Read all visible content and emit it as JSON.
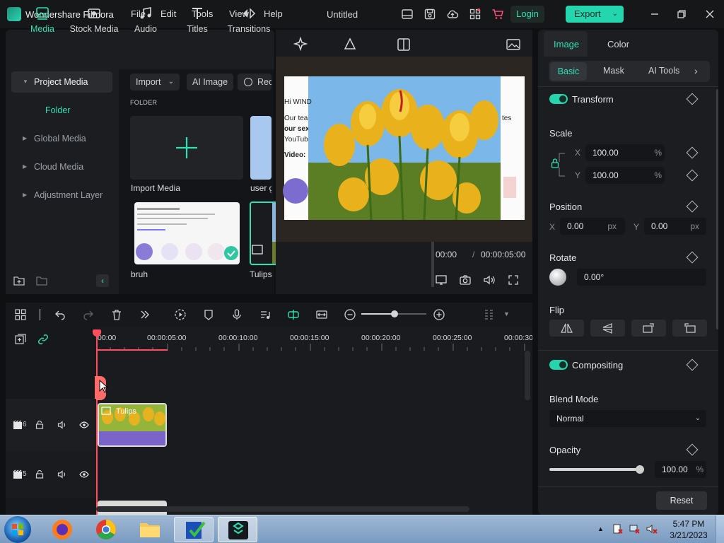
{
  "titlebar": {
    "app_name": "Wondershare Filmora",
    "menus": [
      "File",
      "Edit",
      "Tools",
      "View",
      "Help"
    ],
    "document_title": "Untitled",
    "login_label": "Login",
    "export_label": "Export"
  },
  "media_tabs": [
    {
      "label": "Media",
      "icon": "media-icon"
    },
    {
      "label": "Stock Media",
      "icon": "stock-media-icon"
    },
    {
      "label": "Audio",
      "icon": "music-note-icon"
    },
    {
      "label": "Titles",
      "icon": "text-t-icon"
    },
    {
      "label": "Transitions",
      "icon": "transitions-icon"
    }
  ],
  "preview_tabs_partial": [
    "Effects",
    "Stickers",
    "Templates"
  ],
  "sidebar": {
    "items": [
      {
        "label": "Project Media",
        "active": true
      },
      {
        "label": "Global Media",
        "active": false
      },
      {
        "label": "Cloud Media",
        "active": false
      },
      {
        "label": "Adjustment Layer",
        "active": false
      }
    ],
    "folder_label": "Folder"
  },
  "media_toolbar": {
    "import_label": "Import",
    "ai_image_label": "AI Image",
    "record_label": "Rec"
  },
  "media_grid": {
    "folder_heading": "FOLDER",
    "tiles": [
      {
        "label": "Import Media"
      },
      {
        "label": "user g"
      },
      {
        "label": "bruh"
      },
      {
        "label": "Tulips"
      }
    ]
  },
  "preview": {
    "current_time": "00:00",
    "separator": "/",
    "total_time": "00:00:05:00",
    "doc_text": [
      "Hi WIND",
      "Our team",
      "our sex",
      "YouTube",
      "Video:",
      "tes"
    ]
  },
  "properties": {
    "tabs": [
      "Image",
      "Color"
    ],
    "active_tab": "Image",
    "sub_tabs": [
      "Basic",
      "Mask",
      "AI Tools"
    ],
    "active_sub_tab": "Basic",
    "transform": {
      "label": "Transform",
      "enabled": true
    },
    "scale": {
      "label": "Scale",
      "x_label": "X",
      "x": "100.00",
      "y_label": "Y",
      "y": "100.00",
      "unit": "%"
    },
    "position": {
      "label": "Position",
      "x_label": "X",
      "x": "0.00",
      "y_label": "Y",
      "y": "0.00",
      "unit": "px"
    },
    "rotate": {
      "label": "Rotate",
      "value": "0.00°"
    },
    "flip": {
      "label": "Flip"
    },
    "compositing": {
      "label": "Compositing",
      "enabled": true
    },
    "blend_mode": {
      "label": "Blend Mode",
      "value": "Normal"
    },
    "opacity": {
      "label": "Opacity",
      "value": "100.00",
      "unit": "%",
      "level": 1.0
    },
    "reset_label": "Reset"
  },
  "timeline": {
    "ruler": [
      "00:00",
      "00:00:05:00",
      "00:00:10:00",
      "00:00:15:00",
      "00:00:20:00",
      "00:00:25:00",
      "00:00:30"
    ],
    "tracks": [
      {
        "number": "6"
      },
      {
        "number": "5"
      }
    ],
    "clip_label": "Tulips"
  },
  "taskbar": {
    "time": "5:47 PM",
    "date": "3/21/2023"
  }
}
